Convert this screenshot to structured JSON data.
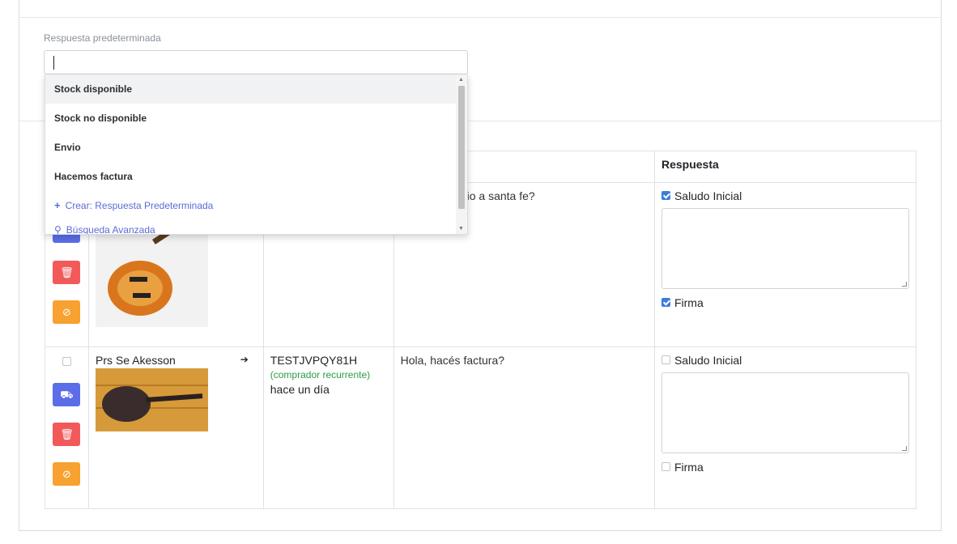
{
  "default_reply": {
    "label": "Respuesta predeterminada",
    "options": [
      "Stock disponible",
      "Stock no disponible",
      "Envio",
      "Hacemos factura"
    ],
    "create_label": "Crear: Respuesta Predeterminada",
    "advanced_label": "Búsqueda Avanzada"
  },
  "table": {
    "header_response": "Respuesta",
    "rows": [
      {
        "question": "io a santa fe?",
        "greeting_label": "Saludo Inicial",
        "greeting_checked": true,
        "signature_label": "Firma",
        "signature_checked": true
      },
      {
        "product": "Prs Se Akesson",
        "buyer_id": "TESTJVPQY81H",
        "buyer_tag": "(comprador recurrente)",
        "time": "hace un día",
        "question": "Hola, hacés factura?",
        "greeting_label": "Saludo Inicial",
        "greeting_checked": false,
        "signature_label": "Firma",
        "signature_checked": false
      }
    ]
  },
  "colors": {
    "accent": "#5b6ee8",
    "danger": "#f25a5a",
    "warning": "#f7a130",
    "success_text": "#2a9d43",
    "link": "#5b6bd6"
  },
  "icons": [
    "truck-icon",
    "trash-icon",
    "ban-icon",
    "arrow-right-icon",
    "plus-icon",
    "search-icon"
  ]
}
